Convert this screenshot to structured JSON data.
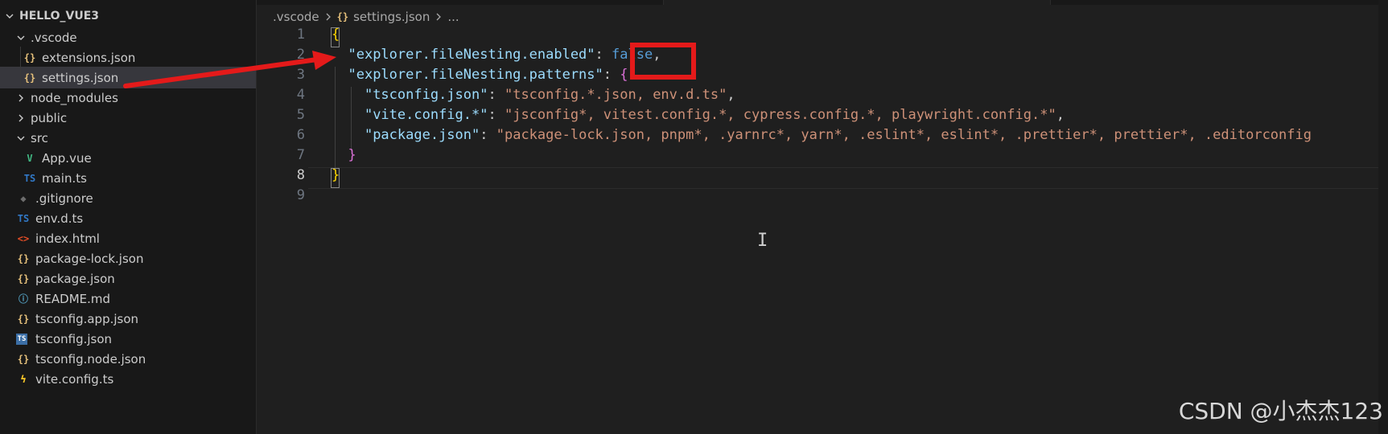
{
  "explorer": {
    "root_label": "HELLO_VUE3",
    "items": [
      {
        "label": ".vscode",
        "icon": "chevron-down-icon",
        "kind": "folder",
        "expanded": true
      },
      {
        "label": "extensions.json",
        "icon": "json-icon",
        "icon_text": "{}"
      },
      {
        "label": "settings.json",
        "icon": "json-icon",
        "icon_text": "{}",
        "selected": true
      },
      {
        "label": "node_modules",
        "icon": "chevron-right-icon",
        "kind": "folder"
      },
      {
        "label": "public",
        "icon": "chevron-right-icon",
        "kind": "folder"
      },
      {
        "label": "src",
        "icon": "chevron-down-icon",
        "kind": "folder",
        "expanded": true
      },
      {
        "label": "App.vue",
        "icon": "vue-icon",
        "icon_text": "V"
      },
      {
        "label": "main.ts",
        "icon": "ts-icon",
        "icon_text": "TS"
      },
      {
        "label": ".gitignore",
        "icon": "git-icon",
        "icon_text": "◆"
      },
      {
        "label": "env.d.ts",
        "icon": "ts-icon",
        "icon_text": "TS"
      },
      {
        "label": "index.html",
        "icon": "html-icon",
        "icon_text": "<>"
      },
      {
        "label": "package-lock.json",
        "icon": "json-icon",
        "icon_text": "{}"
      },
      {
        "label": "package.json",
        "icon": "json-icon",
        "icon_text": "{}"
      },
      {
        "label": "README.md",
        "icon": "info-icon",
        "icon_text": "ⓘ"
      },
      {
        "label": "tsconfig.app.json",
        "icon": "json-icon",
        "icon_text": "{}"
      },
      {
        "label": "tsconfig.json",
        "icon": "tsconfig-icon",
        "icon_text": "TS"
      },
      {
        "label": "tsconfig.node.json",
        "icon": "json-icon",
        "icon_text": "{}"
      },
      {
        "label": "vite.config.ts",
        "icon": "vite-icon",
        "icon_text": "ϟ"
      }
    ]
  },
  "breadcrumb": {
    "folder": ".vscode",
    "file_icon_text": "{}",
    "file": "settings.json",
    "more": "..."
  },
  "editor": {
    "lines": [
      {
        "no": "1",
        "tokens": [
          {
            "t": "{",
            "c": "b1"
          }
        ]
      },
      {
        "no": "2",
        "tokens": [
          {
            "t": "  ",
            "c": "pun"
          },
          {
            "t": "\"explorer.fileNesting.enabled\"",
            "c": "key"
          },
          {
            "t": ": ",
            "c": "pun"
          },
          {
            "t": "false",
            "c": "kw"
          },
          {
            "t": ",",
            "c": "pun"
          }
        ]
      },
      {
        "no": "3",
        "tokens": [
          {
            "t": "  ",
            "c": "pun"
          },
          {
            "t": "\"explorer.fileNesting.patterns\"",
            "c": "key"
          },
          {
            "t": ": ",
            "c": "pun"
          },
          {
            "t": "{",
            "c": "b2"
          }
        ]
      },
      {
        "no": "4",
        "tokens": [
          {
            "t": "    ",
            "c": "pun"
          },
          {
            "t": "\"tsconfig.json\"",
            "c": "key"
          },
          {
            "t": ": ",
            "c": "pun"
          },
          {
            "t": "\"tsconfig.*.json, env.d.ts\"",
            "c": "str"
          },
          {
            "t": ",",
            "c": "pun"
          }
        ]
      },
      {
        "no": "5",
        "tokens": [
          {
            "t": "    ",
            "c": "pun"
          },
          {
            "t": "\"vite.config.*\"",
            "c": "key"
          },
          {
            "t": ": ",
            "c": "pun"
          },
          {
            "t": "\"jsconfig*, vitest.config.*, cypress.config.*, playwright.config.*\"",
            "c": "str"
          },
          {
            "t": ",",
            "c": "pun"
          }
        ]
      },
      {
        "no": "6",
        "tokens": [
          {
            "t": "    ",
            "c": "pun"
          },
          {
            "t": "\"package.json\"",
            "c": "key"
          },
          {
            "t": ": ",
            "c": "pun"
          },
          {
            "t": "\"package-lock.json, pnpm*, .yarnrc*, yarn*, .eslint*, eslint*, .prettier*, prettier*, .editorconfig",
            "c": "str"
          }
        ]
      },
      {
        "no": "7",
        "tokens": [
          {
            "t": "  ",
            "c": "pun"
          },
          {
            "t": "}",
            "c": "b2"
          }
        ]
      },
      {
        "no": "8",
        "tokens": [
          {
            "t": "}",
            "c": "b1"
          }
        ],
        "current": true
      },
      {
        "no": "9",
        "tokens": []
      }
    ]
  },
  "watermark": "CSDN @小杰杰123",
  "colors": {
    "annotation_red": "#e41a1a",
    "editor_bg": "#1f1f1f",
    "sidebar_bg": "#181818",
    "selected_row": "#37373d"
  }
}
